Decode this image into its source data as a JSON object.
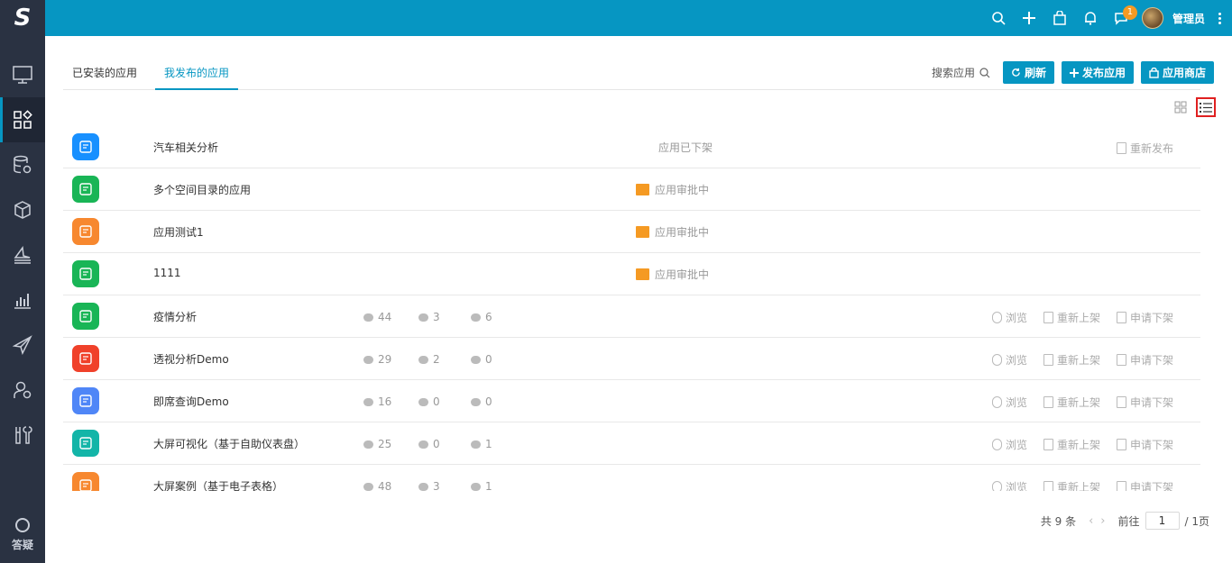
{
  "topbar": {
    "logo_text": "S",
    "notification_count": "1",
    "user_name": "管理员",
    "icons": [
      "search-icon",
      "plus-icon",
      "shopping-bag-icon",
      "bell-icon",
      "chat-icon",
      "avatar",
      "more-icon"
    ]
  },
  "sidebar": {
    "items": [
      "monitor-icon",
      "apps-icon",
      "database-settings-icon",
      "cube-icon",
      "layers-icon",
      "chart-icon",
      "send-icon",
      "user-settings-icon",
      "tools-icon"
    ],
    "active_index": 1,
    "help_label": "答疑"
  },
  "tabs": [
    {
      "label": "已安装的应用",
      "active": false
    },
    {
      "label": "我发布的应用",
      "active": true
    }
  ],
  "toolbar": {
    "search_label": "搜索应用",
    "refresh_label": "刷新",
    "publish_label": "发布应用",
    "store_label": "应用商店"
  },
  "colors": {
    "primary": "#0696c2",
    "sidebar": "#2a3242",
    "warning": "#f59a23"
  },
  "apps": [
    {
      "name": "汽车相关分析",
      "icon_color": "#1890ff",
      "status": "应用已下架",
      "status_icon": false,
      "stats": null,
      "actions": [
        "重新发布"
      ]
    },
    {
      "name": "多个空间目录的应用",
      "icon_color": "#19b556",
      "status": "应用审批中",
      "status_icon": true,
      "stats": null,
      "actions": []
    },
    {
      "name": "应用测试1",
      "icon_color": "#f7882f",
      "status": "应用审批中",
      "status_icon": true,
      "stats": null,
      "actions": []
    },
    {
      "name": "1111",
      "icon_color": "#19b556",
      "status": "应用审批中",
      "status_icon": true,
      "stats": null,
      "actions": []
    },
    {
      "name": "疫情分析",
      "icon_color": "#19b556",
      "status": "",
      "status_icon": false,
      "stats": {
        "views": "44",
        "downloads": "3",
        "comments": "6"
      },
      "actions": [
        "浏览",
        "重新上架",
        "申请下架"
      ]
    },
    {
      "name": "透视分析Demo",
      "icon_color": "#f0412a",
      "status": "",
      "status_icon": false,
      "stats": {
        "views": "29",
        "downloads": "2",
        "comments": "0"
      },
      "actions": [
        "浏览",
        "重新上架",
        "申请下架"
      ]
    },
    {
      "name": "即席查询Demo",
      "icon_color": "#4f86f7",
      "status": "",
      "status_icon": false,
      "stats": {
        "views": "16",
        "downloads": "0",
        "comments": "0"
      },
      "actions": [
        "浏览",
        "重新上架",
        "申请下架"
      ]
    },
    {
      "name": "大屏可视化（基于自助仪表盘）",
      "icon_color": "#13b5a8",
      "status": "",
      "status_icon": false,
      "stats": {
        "views": "25",
        "downloads": "0",
        "comments": "1"
      },
      "actions": [
        "浏览",
        "重新上架",
        "申请下架"
      ]
    },
    {
      "name": "大屏案例（基于电子表格）",
      "icon_color": "#f7882f",
      "status": "",
      "status_icon": false,
      "stats": {
        "views": "48",
        "downloads": "3",
        "comments": "1"
      },
      "actions": [
        "浏览",
        "重新上架",
        "申请下架"
      ]
    }
  ],
  "pagination": {
    "total_label": "共 9 条",
    "goto_label": "前往",
    "page_value": "1",
    "pages_label": "/ 1页"
  }
}
